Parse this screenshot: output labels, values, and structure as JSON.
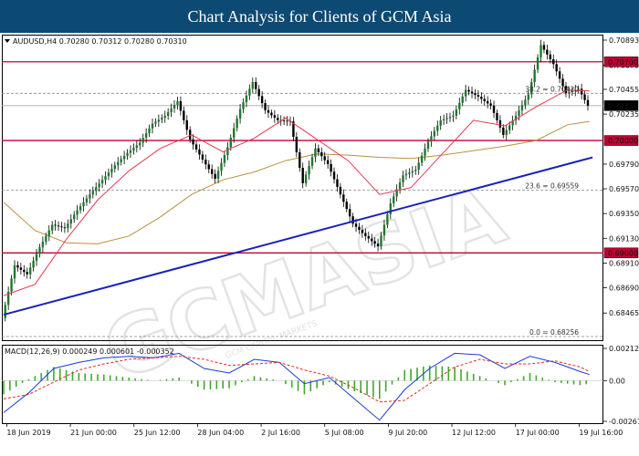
{
  "banner": {
    "title": "Chart Analysis for Clients of GCM Asia"
  },
  "colors": {
    "price_line": "#e63950",
    "ma_slow": "#b8913a",
    "trendline": "#1a22b8",
    "level": "#c00030",
    "macd_line": "#1a3ad8",
    "signal_line": "#e02a20",
    "histogram": "#3fa82a",
    "label_fill": "#c00030"
  },
  "watermark": {
    "text": "GCMASIA",
    "subtext": "GCM CAPITAL MARKETS"
  },
  "chart_data": [
    {
      "type": "line",
      "header": "AUDUSD,H4  0.70280 0.70312 0.70280 0.70310",
      "ylim": [
        0.68256,
        0.70893
      ],
      "y_ticks": [
        "0.70893",
        "0.70670",
        "0.70455",
        "0.70235",
        "0.69790",
        "0.69570",
        "0.69350",
        "0.69130",
        "0.68910",
        "0.68690",
        "0.68465"
      ],
      "x_ticks": [
        "18 Jun 2019",
        "21 Jun 00:00",
        "25 Jun 12:00",
        "28 Jun 04:00",
        "2 Jul 16:00",
        "5 Jul 08:00",
        "9 Jul 20:00",
        "12 Jul 12:00",
        "17 Jul 00:00",
        "19 Jul 16:00"
      ],
      "series": [
        {
          "x": [
            0,
            4,
            8,
            12,
            16,
            20,
            24,
            28,
            32,
            36,
            40,
            44,
            48,
            52,
            56,
            60,
            64,
            68,
            72,
            76,
            80,
            84,
            88,
            92,
            96,
            100,
            104,
            108,
            112,
            116,
            120,
            124,
            128,
            132,
            136,
            140,
            144,
            148,
            152,
            156,
            160,
            164,
            168,
            172,
            176,
            180,
            184,
            187
          ],
          "values": [
            0.6842,
            0.6889,
            0.6881,
            0.6905,
            0.6925,
            0.6922,
            0.6938,
            0.6952,
            0.6965,
            0.6978,
            0.6989,
            0.6998,
            0.7015,
            0.7022,
            0.7035,
            0.7001,
            0.6983,
            0.6966,
            0.6994,
            0.7028,
            0.7052,
            0.7027,
            0.7018,
            0.7017,
            0.6962,
            0.6993,
            0.6979,
            0.6952,
            0.6926,
            0.6915,
            0.6906,
            0.6944,
            0.6969,
            0.6974,
            0.6999,
            0.7018,
            0.7022,
            0.7045,
            0.7039,
            0.7031,
            0.7005,
            0.7022,
            0.7041,
            0.7085,
            0.7068,
            0.7042,
            0.7046,
            0.7031
          ]
        }
      ],
      "moving_average_fast": {
        "x": [
          0,
          10,
          20,
          30,
          40,
          50,
          60,
          70,
          80,
          90,
          100,
          110,
          120,
          130,
          140,
          150,
          160,
          170,
          180,
          187
        ],
        "values": [
          0.6862,
          0.6872,
          0.6912,
          0.6947,
          0.6973,
          0.6993,
          0.7005,
          0.699,
          0.7002,
          0.702,
          0.7001,
          0.6982,
          0.6952,
          0.6958,
          0.6988,
          0.7018,
          0.7013,
          0.703,
          0.7045,
          0.7044
        ]
      },
      "moving_average_slow": {
        "x": [
          0,
          10,
          20,
          30,
          40,
          50,
          60,
          70,
          80,
          90,
          100,
          110,
          120,
          130,
          140,
          150,
          160,
          170,
          180,
          187
        ],
        "values": [
          0.6945,
          0.692,
          0.6909,
          0.6908,
          0.6915,
          0.6932,
          0.6952,
          0.6965,
          0.6972,
          0.6982,
          0.6988,
          0.6987,
          0.6985,
          0.6984,
          0.6987,
          0.6991,
          0.6995,
          0.7,
          0.7014,
          0.7017
        ]
      },
      "trendline": {
        "x": [
          0,
          188
        ],
        "values": [
          0.6845,
          0.6985
        ]
      },
      "levels": [
        {
          "price": 0.707,
          "label": "0.70700"
        },
        {
          "price": 0.7,
          "label": "0.70000"
        },
        {
          "price": 0.69,
          "label": "0.69000"
        }
      ],
      "fib_levels": [
        {
          "price": 0.7042,
          "label": "38.2 = 0.70420"
        },
        {
          "price": 0.69559,
          "label": "23.6 = 0.69559"
        },
        {
          "price": 0.68256,
          "label": "0.0 = 0.68256"
        }
      ],
      "current_price": {
        "price": 0.7031,
        "label": "0.70310"
      }
    },
    {
      "type": "line",
      "header": "MACD(12,26,9) 0.000249 0.000601 -0.000352",
      "ylim": [
        -0.002678,
        0.002123
      ],
      "y_ticks": [
        "0.002123",
        "0.00",
        "-0.002678"
      ],
      "series": [
        {
          "name": "MACD",
          "x": [
            0,
            8,
            16,
            24,
            32,
            40,
            48,
            56,
            64,
            72,
            80,
            88,
            96,
            104,
            112,
            120,
            128,
            136,
            144,
            152,
            160,
            168,
            176,
            184,
            187
          ],
          "values": [
            -0.0021,
            -0.0008,
            0.0008,
            0.0012,
            0.0015,
            0.0016,
            0.0015,
            0.0018,
            0.0008,
            0.0005,
            0.0014,
            0.0012,
            -0.0002,
            0.0002,
            -0.0012,
            -0.0026,
            -0.0006,
            0.0008,
            0.0018,
            0.0017,
            0.0008,
            0.0016,
            0.0012,
            0.0006,
            0.0004
          ]
        },
        {
          "name": "Signal",
          "x": [
            0,
            8,
            16,
            24,
            32,
            40,
            48,
            56,
            64,
            72,
            80,
            88,
            96,
            104,
            112,
            120,
            128,
            136,
            144,
            152,
            160,
            168,
            176,
            184,
            187
          ],
          "values": [
            -0.0012,
            -0.0009,
            -0.0001,
            0.0007,
            0.0011,
            0.0014,
            0.0015,
            0.0016,
            0.0014,
            0.001,
            0.0011,
            0.0012,
            0.0007,
            0.0003,
            -0.0005,
            -0.0014,
            -0.0013,
            -0.0002,
            0.0009,
            0.0014,
            0.0011,
            0.0011,
            0.0013,
            0.0009,
            0.0006
          ]
        }
      ]
    }
  ]
}
